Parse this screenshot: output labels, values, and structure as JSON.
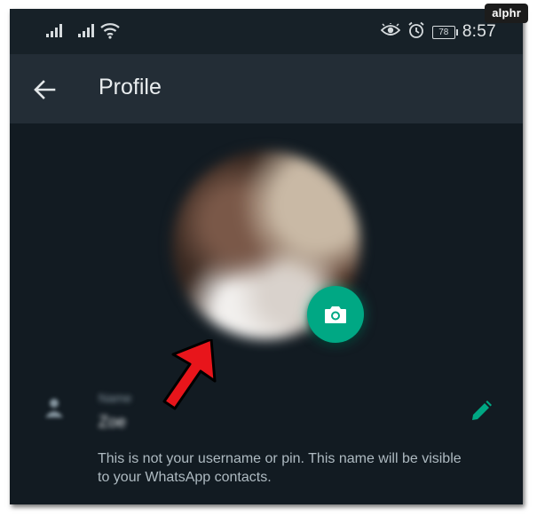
{
  "status_bar": {
    "time": "8:57",
    "battery_level": "78",
    "icons": [
      "signal-icon",
      "signal-icon",
      "wifi-icon",
      "eye-comfort-icon",
      "alarm-icon",
      "battery-icon"
    ]
  },
  "app_bar": {
    "title": "Profile",
    "back_icon": "arrow-left-icon"
  },
  "profile": {
    "photo_icon": "camera-icon",
    "name_label": "Name",
    "name_value": "Zoe",
    "edit_icon": "pencil-icon",
    "help_text": "This is not your username or pin. This name will be visible to your WhatsApp contacts."
  },
  "watermark": "alphr",
  "colors": {
    "accent": "#00a884",
    "background": "#121b22",
    "app_bar": "#232d36",
    "arrow_annotation": "#e8151b"
  }
}
